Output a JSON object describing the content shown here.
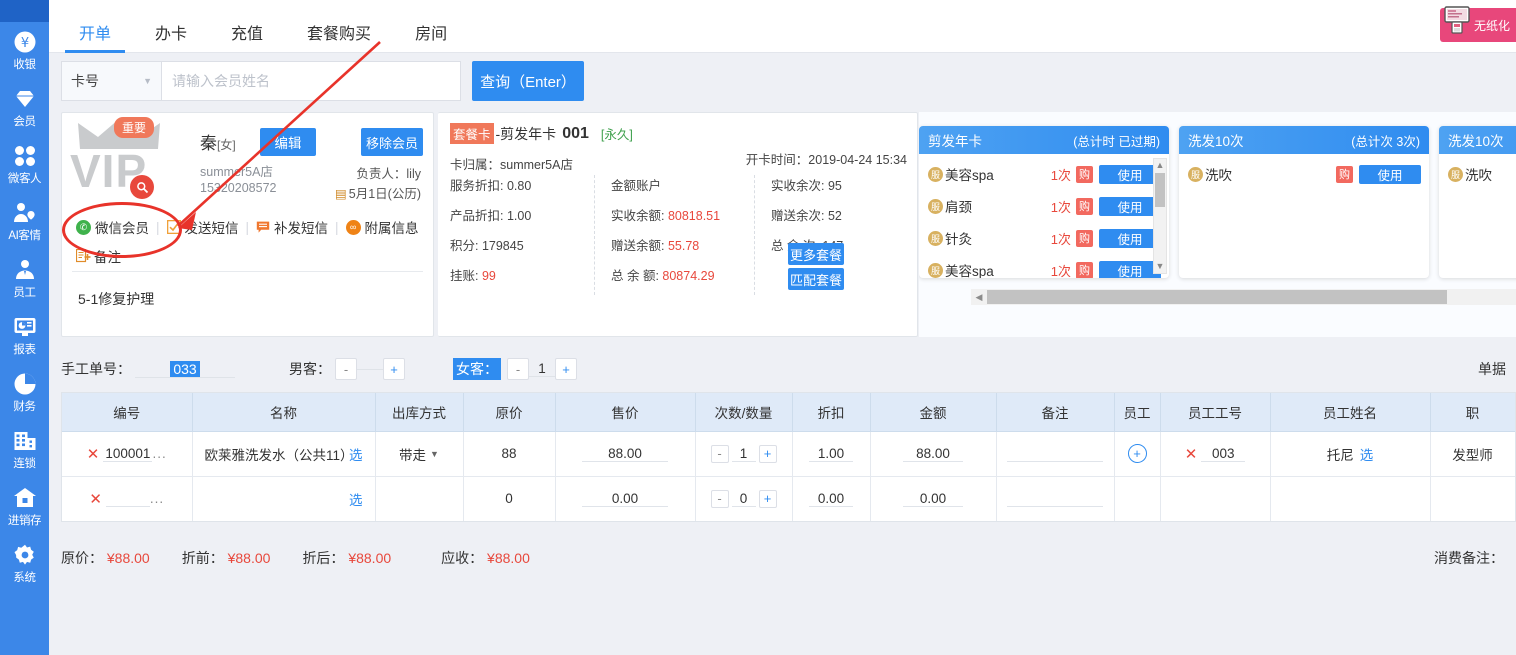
{
  "sidebar": {
    "items": [
      {
        "label": "收银",
        "icon": "cashier-icon"
      },
      {
        "label": "会员",
        "icon": "member-diamond-icon"
      },
      {
        "label": "微客人",
        "icon": "clover-icon"
      },
      {
        "label": "AI客情",
        "icon": "ai-customer-icon"
      },
      {
        "label": "员工",
        "icon": "staff-person-icon"
      },
      {
        "label": "报表",
        "icon": "report-monitor-icon"
      },
      {
        "label": "财务",
        "icon": "finance-pie-icon"
      },
      {
        "label": "连锁",
        "icon": "chain-building-icon"
      },
      {
        "label": "进销存",
        "icon": "inventory-house-icon"
      },
      {
        "label": "系统",
        "icon": "gear-icon"
      }
    ]
  },
  "header": {
    "tabs": [
      {
        "label": "开单",
        "active": true
      },
      {
        "label": "办卡",
        "active": false
      },
      {
        "label": "充值",
        "active": false
      },
      {
        "label": "套餐购买",
        "active": false
      },
      {
        "label": "房间",
        "active": false
      }
    ],
    "paperless_label": "无纸化"
  },
  "search": {
    "card_type": "卡号",
    "input_value": "",
    "placeholder": "请输入会员姓名",
    "query_button": "查询（Enter）"
  },
  "member": {
    "vip_watermark": "VIP",
    "badge": "重要",
    "name": "秦",
    "gender": "[女]",
    "shop": "summer5A店",
    "phone": "15320208572",
    "edit_button": "编辑",
    "remove_button": "移除会员",
    "owner_label": "负责人：",
    "owner": "lily",
    "birthday": "5月1日(公历)",
    "actions": [
      {
        "label": "微信会员",
        "icon": "wechat-icon"
      },
      {
        "label": "发送短信",
        "icon": "sms-send-icon"
      },
      {
        "label": "补发短信",
        "icon": "sms-resend-icon"
      },
      {
        "label": "附属信息",
        "icon": "attachment-icon"
      }
    ],
    "remark_label": "备注",
    "note": "5-1修复护理"
  },
  "card_detail": {
    "tag": "套餐卡",
    "name": "-剪发年卡",
    "number": "001",
    "validity": "[永久]",
    "belong_label": "卡归属：",
    "belong": "summer5A店",
    "open_time_label": "开卡时间：",
    "open_time": "2019-04-24 15:34",
    "col1": [
      {
        "label": "服务折扣: ",
        "value": "0.80",
        "red": false
      },
      {
        "label": "产品折扣: ",
        "value": "1.00",
        "red": false
      },
      {
        "label": "积分: ",
        "value": "179845",
        "red": false
      },
      {
        "label": "挂账: ",
        "value": "99",
        "red": true
      }
    ],
    "col2": [
      {
        "label": "金额账户",
        "value": "",
        "red": false
      },
      {
        "label": "实收余额: ",
        "value": "80818.51",
        "red": true
      },
      {
        "label": "赠送余额: ",
        "value": "55.78",
        "red": true
      },
      {
        "label": "总 余 额: ",
        "value": "80874.29",
        "red": true
      }
    ],
    "col3": [
      {
        "label": "实收余次: ",
        "value": "95",
        "red": false
      },
      {
        "label": "赠送余次: ",
        "value": "52",
        "red": false
      },
      {
        "label": "总 余 次: ",
        "value": "147",
        "red": false
      }
    ],
    "more_package_button": "更多套餐",
    "match_package_button": "匹配套餐"
  },
  "packages": [
    {
      "title": "剪发年卡",
      "count_label": "(总计时 已过期)",
      "rows": [
        {
          "name": "美容spa",
          "times": "1次",
          "buy": "购",
          "use": "使用"
        },
        {
          "name": "肩颈",
          "times": "1次",
          "buy": "购",
          "use": "使用"
        },
        {
          "name": "针灸",
          "times": "1次",
          "buy": "购",
          "use": "使用"
        },
        {
          "name": "美容spa",
          "times": "1次",
          "buy": "购",
          "use": "使用"
        }
      ],
      "has_scrollbar": true
    },
    {
      "title": "洗发10次",
      "count_label": "(总计次 3次)",
      "rows": [
        {
          "name": "洗吹",
          "times": "",
          "buy": "购",
          "use": "使用"
        }
      ],
      "has_scrollbar": false
    },
    {
      "title": "洗发10次",
      "count_label": "",
      "rows": [
        {
          "name": "洗吹",
          "times": "",
          "buy": "",
          "use": ""
        }
      ],
      "has_scrollbar": false
    }
  ],
  "order_row": {
    "manual_no_label": "手工单号：",
    "manual_no_value": "033",
    "male_label": "男客：",
    "male_value": "",
    "female_label": "女客：",
    "female_value": "1",
    "minus": "-",
    "plus": "+",
    "bill_label": "单据"
  },
  "table": {
    "columns": [
      "编号",
      "名称",
      "出库方式",
      "原价",
      "售价",
      "次数/数量",
      "折扣",
      "金额",
      "备注",
      "员工",
      "员工工号",
      "员工姓名",
      "职"
    ],
    "rows": [
      {
        "code": "100001",
        "dots": "...",
        "name": "欧莱雅洗发水（公共11）",
        "select": "选",
        "out_method": "带走",
        "original_price": "88",
        "sale_price": "88.00",
        "qty": "1",
        "discount": "1.00",
        "amount": "88.00",
        "remark": "",
        "staff_add": "+",
        "staff_no": "003",
        "staff_name": "托尼",
        "staff_select": "选",
        "position": "发型师"
      },
      {
        "code": "",
        "dots": "...",
        "name": "",
        "select": "选",
        "out_method": "",
        "original_price": "0",
        "sale_price": "0.00",
        "qty": "0",
        "discount": "0.00",
        "amount": "0.00",
        "remark": "",
        "staff_add": "",
        "staff_no": "",
        "staff_name": "",
        "staff_select": "",
        "position": ""
      }
    ]
  },
  "totals": {
    "original_label": "原价：",
    "original_value": "¥88.00",
    "before_label": "折前：",
    "before_value": "¥88.00",
    "after_label": "折后：",
    "after_value": "¥88.00",
    "receivable_label": "应收：",
    "receivable_value": "¥88.00",
    "consume_remark_label": "消费备注："
  },
  "colors": {
    "sidebar": "#3c87e8",
    "accent": "#2f8cf0",
    "danger": "#e8483c",
    "warning": "#f0785a",
    "header_row": "#dfeaf8",
    "page_bg": "#eef0f5"
  }
}
